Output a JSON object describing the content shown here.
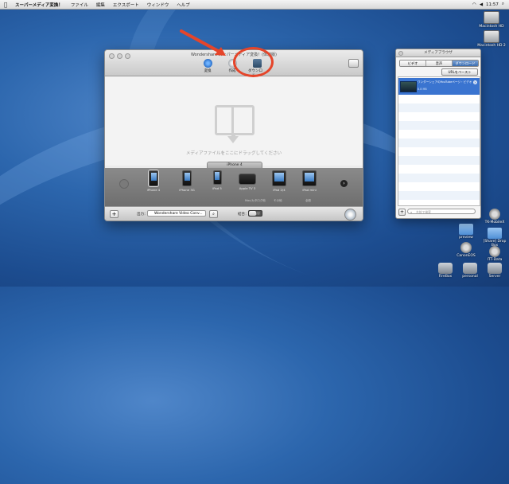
{
  "menubar": {
    "app_name": "スーパーメディア変換！",
    "items": [
      "ファイル",
      "編集",
      "エクスポート",
      "ウィンドウ",
      "ヘルプ"
    ],
    "clock": "11:57"
  },
  "desktop_icons": [
    {
      "label": "Macintosh HD",
      "kind": "hd"
    },
    {
      "label": "Macintosh HD 2",
      "kind": "hd"
    },
    {
      "label": "preview",
      "kind": "folder"
    },
    {
      "label": "TK-MobileX",
      "kind": "disk"
    },
    {
      "label": "[Share] Drop Box",
      "kind": "folder"
    },
    {
      "label": "CanonEOS",
      "kind": "disk"
    },
    {
      "label": "ITT-Data",
      "kind": "disk"
    },
    {
      "label": "FireBox",
      "kind": "drive"
    },
    {
      "label": "personal",
      "kind": "drive"
    },
    {
      "label": "Server",
      "kind": "drive"
    }
  ],
  "main_window": {
    "title": "Wondershare スーパーメディア変換！(体験版)",
    "toolbar": {
      "convert_label": "変換",
      "create_label": "作成",
      "download_label": "ダウンロード"
    },
    "drop_text": "メディアファイルをここにドラッグしてください",
    "device_tab": "iPhone 4",
    "devices": [
      {
        "label": "iPhone 4",
        "sub": "",
        "kind": "phone",
        "selected": true
      },
      {
        "label": "iPhone 3G",
        "sub": "",
        "kind": "phone",
        "selected": false
      },
      {
        "label": "iPod 5",
        "sub": "",
        "kind": "ipod",
        "selected": false
      },
      {
        "label": "Apple TV 3",
        "sub": "",
        "kind": "appletv",
        "selected": false
      },
      {
        "label": "iPad 2/4",
        "sub": "",
        "kind": "tablet",
        "selected": false
      },
      {
        "label": "iPad mini",
        "sub": "",
        "kind": "tablet",
        "selected": false
      }
    ],
    "device_subrow": [
      "",
      "",
      "",
      "Mac/カタログ他",
      "その他",
      "全般"
    ],
    "bottom": {
      "add_label": "+",
      "output_label": "出力：",
      "output_value": "Wondershare Video Conv...",
      "merge_label": "結合：",
      "toggle_label": "OFF"
    }
  },
  "media_browser": {
    "title": "メディアブラウザ",
    "tabs": [
      {
        "label": "ビデオ",
        "active": false
      },
      {
        "label": "音声",
        "active": false
      },
      {
        "label": "ダウンロード",
        "active": true
      }
    ],
    "url_button": "URLをペースト",
    "items": [
      {
        "title": "ワンダーシェアのYouTubeページ・ビデオ",
        "size": "8.8 MB"
      }
    ],
    "search_placeholder": "名前で検索"
  },
  "colors": {
    "annotation": "#e5452a",
    "selection": "#3a74d0"
  }
}
